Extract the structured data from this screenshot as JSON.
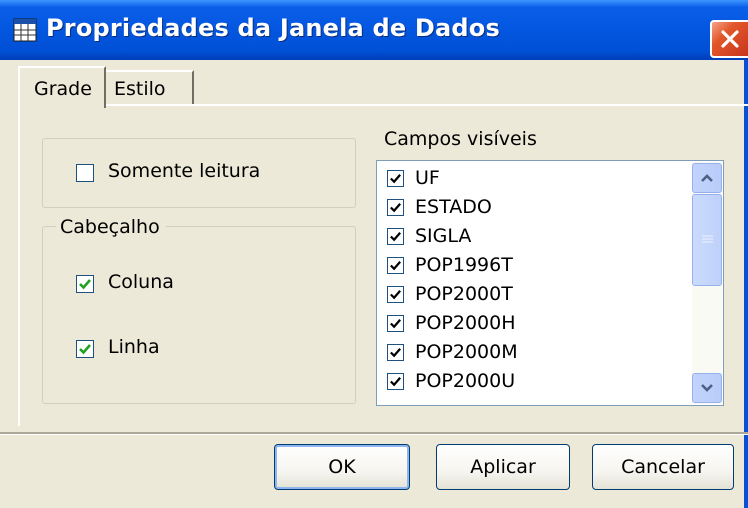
{
  "window": {
    "title": "Propriedades da Janela de Dados",
    "icon": "table-window-icon",
    "close_icon": "close-icon"
  },
  "tabs": [
    {
      "label": "Grade",
      "selected": true
    },
    {
      "label": "Estilo",
      "selected": false
    }
  ],
  "readonly": {
    "label": "Somente leitura",
    "checked": false
  },
  "cabecalho": {
    "title": "Cabeçalho",
    "coluna": {
      "label": "Coluna",
      "checked": true
    },
    "linha": {
      "label": "Linha",
      "checked": true
    }
  },
  "campos": {
    "label": "Campos visíveis",
    "items": [
      {
        "label": "UF",
        "checked": true
      },
      {
        "label": "ESTADO",
        "checked": true
      },
      {
        "label": "SIGLA",
        "checked": true
      },
      {
        "label": "POP1996T",
        "checked": true
      },
      {
        "label": "POP2000T",
        "checked": true
      },
      {
        "label": "POP2000H",
        "checked": true
      },
      {
        "label": "POP2000M",
        "checked": true
      },
      {
        "label": "POP2000U",
        "checked": true
      }
    ]
  },
  "buttons": {
    "ok": "OK",
    "aplicar": "Aplicar",
    "cancelar": "Cancelar"
  },
  "colors": {
    "titlebar": "#0356E0",
    "dialog_bg": "#ECE9D8",
    "close": "#E2572B"
  }
}
